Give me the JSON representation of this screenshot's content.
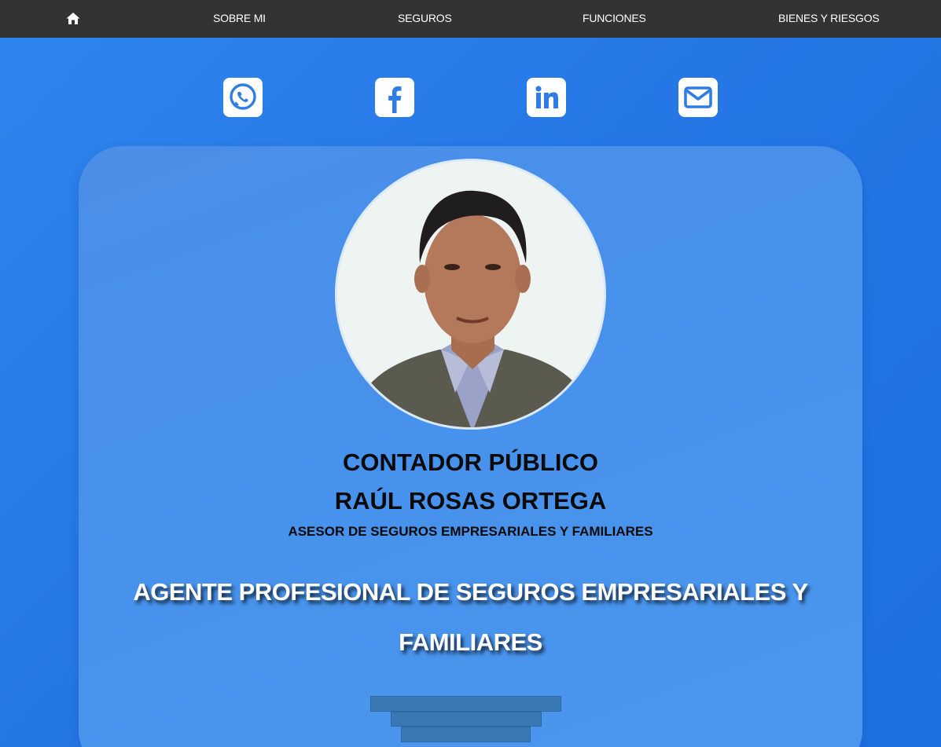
{
  "nav": {
    "home_icon": "home-icon",
    "items": [
      {
        "label": "SOBRE MI"
      },
      {
        "label": "SEGUROS"
      },
      {
        "label": "FUNCIONES"
      },
      {
        "label": "BIENES Y RIESGOS"
      }
    ]
  },
  "social": {
    "icons": [
      "whatsapp-icon",
      "facebook-icon",
      "linkedin-icon",
      "envelope-icon"
    ],
    "icon_color": "#2f7de4"
  },
  "profile": {
    "title": "CONTADOR PÚBLICO",
    "name": "RAÚL ROSAS ORTEGA",
    "subtitle": "ASESOR DE SEGUROS EMPRESARIALES Y FAMILIARES",
    "tagline": "AGENTE PROFESIONAL DE SEGUROS EMPRESARIALES Y FAMILIARES"
  },
  "colors": {
    "nav_bg": "#333333",
    "page_bg": "#2677e6",
    "card_bg": "#4792ec",
    "step_color": "#3a78b4"
  }
}
